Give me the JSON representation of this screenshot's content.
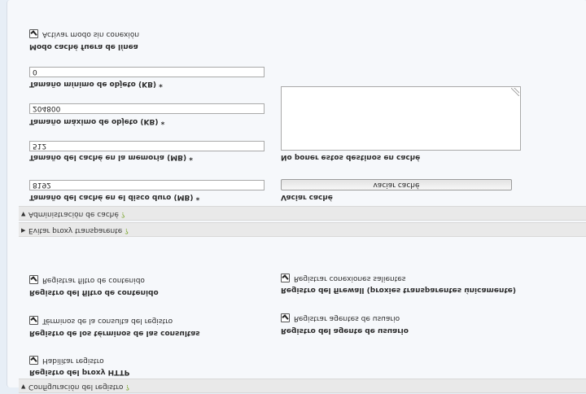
{
  "sections": {
    "log_config": {
      "label": "Configuración del registro",
      "help": "?"
    },
    "transparent_proxy": {
      "label": "Evitar proxy transparente",
      "help": "?"
    },
    "cache_admin": {
      "label": "Administración de caché",
      "help": "?"
    }
  },
  "logging": {
    "http_proxy_log": {
      "title": "Registro del proxy HTTP",
      "checkbox": "Habilitar registro",
      "checked": true
    },
    "query_terms": {
      "title": "Registro de los términos de las consultas",
      "checkbox": "Términos de la consulta del registro",
      "checked": true
    },
    "user_agent": {
      "title": "Registro del agente de usuario",
      "checkbox": "Registrar agentes de usuario",
      "checked": true
    },
    "content_filter": {
      "title": "Registro del filtro de contenido",
      "checkbox": "Registrar filtro de contenido",
      "checked": true
    },
    "firewall": {
      "title": "Registro del firewall (proxies transparentes únicamente)",
      "checkbox": "Registrar conexiones salientes",
      "checked": true
    }
  },
  "cache": {
    "disk_size": {
      "label": "Tamaño del caché en el disco duro (MB) *",
      "value": "8192"
    },
    "clear_cache": {
      "label": "Vaciar caché",
      "button": "vaciar caché"
    },
    "memory_size": {
      "label": "Tamaño del caché en la memoria (MB) *",
      "value": "512"
    },
    "no_cache_dest": {
      "label": "No poner estos destinos en caché",
      "value": ""
    },
    "max_object": {
      "label": "Tamaño máximo de objeto (KB) *",
      "value": "204800"
    },
    "min_object": {
      "label": "Tamaño mínimo de objeto (KB) *",
      "value": "0"
    },
    "offline_mode": {
      "title": "Modo caché fuera de línea",
      "checkbox": "Activar modo sin conexión",
      "checked": true
    }
  }
}
